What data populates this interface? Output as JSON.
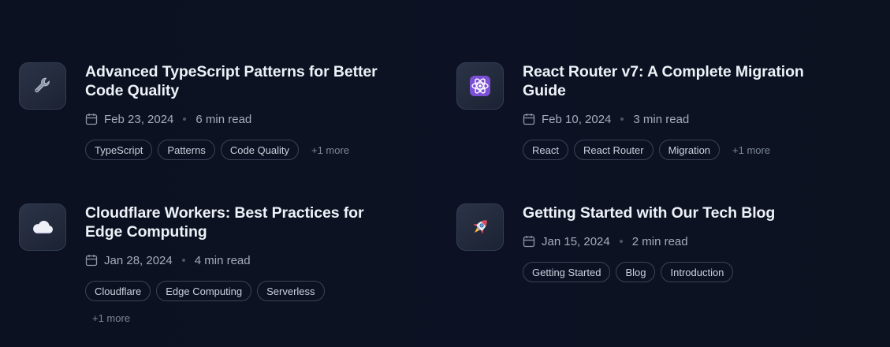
{
  "posts": [
    {
      "icon": "wrench-icon",
      "title": "Advanced TypeScript Patterns for Better Code Quality",
      "date": "Feb 23, 2024",
      "read_time": "6 min read",
      "tags": [
        "TypeScript",
        "Patterns",
        "Code Quality"
      ],
      "more": "+1 more"
    },
    {
      "icon": "atom-icon",
      "title": "React Router v7: A Complete Migration Guide",
      "date": "Feb 10, 2024",
      "read_time": "3 min read",
      "tags": [
        "React",
        "React Router",
        "Migration"
      ],
      "more": "+1 more"
    },
    {
      "icon": "cloud-icon",
      "title": "Cloudflare Workers: Best Practices for Edge Computing",
      "date": "Jan 28, 2024",
      "read_time": "4 min read",
      "tags": [
        "Cloudflare",
        "Edge Computing",
        "Serverless"
      ],
      "more": "+1 more"
    },
    {
      "icon": "rocket-icon",
      "title": "Getting Started with Our Tech Blog",
      "date": "Jan 15, 2024",
      "read_time": "2 min read",
      "tags": [
        "Getting Started",
        "Blog",
        "Introduction"
      ],
      "more": ""
    }
  ],
  "colors": {
    "background": "#0b1120",
    "tag_border": "#3a4457",
    "meta_text": "#a3adbd"
  }
}
